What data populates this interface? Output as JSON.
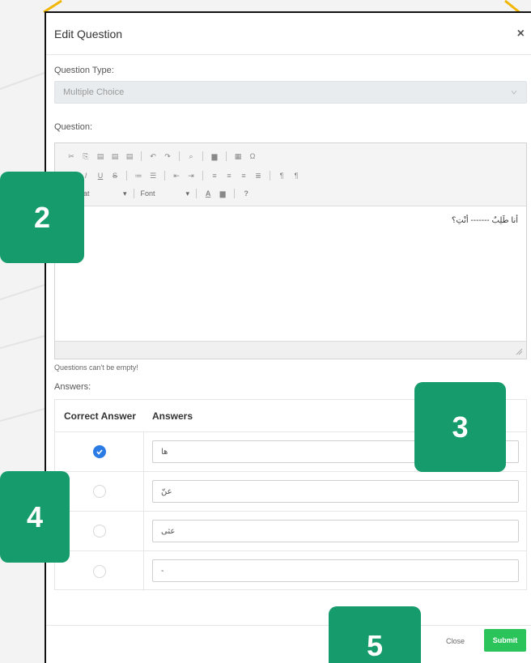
{
  "modal": {
    "title": "Edit Question",
    "close_icon": "close-x-icon",
    "question_type": {
      "label": "Question Type:",
      "value": "Multiple Choice"
    },
    "question": {
      "label": "Question:",
      "toolbar": {
        "row1_icons": [
          "cut-icon",
          "copy-icon",
          "paste-icon",
          "paste-text-icon",
          "paste-word-icon",
          "undo-icon",
          "redo-icon",
          "find-icon",
          "select-all-icon",
          "table-icon",
          "special-char-icon"
        ],
        "row2_icons": [
          "bold-icon",
          "italic-icon",
          "underline-icon",
          "strike-icon",
          "ordered-list-icon",
          "bullet-list-icon",
          "outdent-icon",
          "indent-icon",
          "align-left-icon",
          "align-center-icon",
          "align-right-icon",
          "justify-icon",
          "ltr-icon",
          "rtl-icon"
        ],
        "format_dropdown": "Format",
        "font_dropdown": "Font",
        "text_color_icon": "text-color-icon",
        "bg_color_icon": "bg-color-icon",
        "help_label": "?"
      },
      "content": "أنا طَلِبٌ ------- أنْتِ؟"
    },
    "validation_message": "Questions can't be empty!",
    "answers": {
      "label": "Answers:",
      "columns": {
        "correct": "Correct Answer",
        "answers": "Answers"
      },
      "rows": [
        {
          "correct": true,
          "value": "ها"
        },
        {
          "correct": false,
          "value": "عنّ"
        },
        {
          "correct": false,
          "value": "عثى"
        },
        {
          "correct": false,
          "value": "-"
        }
      ]
    },
    "footer": {
      "close_label": "Close",
      "submit_label": "Submit"
    }
  },
  "badges": [
    {
      "label": "2"
    },
    {
      "label": "3"
    },
    {
      "label": "4"
    },
    {
      "label": "5"
    }
  ],
  "colors": {
    "badge": "#169b6c",
    "submit": "#2bc45b",
    "radio_checked": "#2a7be4",
    "accent_lines": "#f2b705"
  }
}
